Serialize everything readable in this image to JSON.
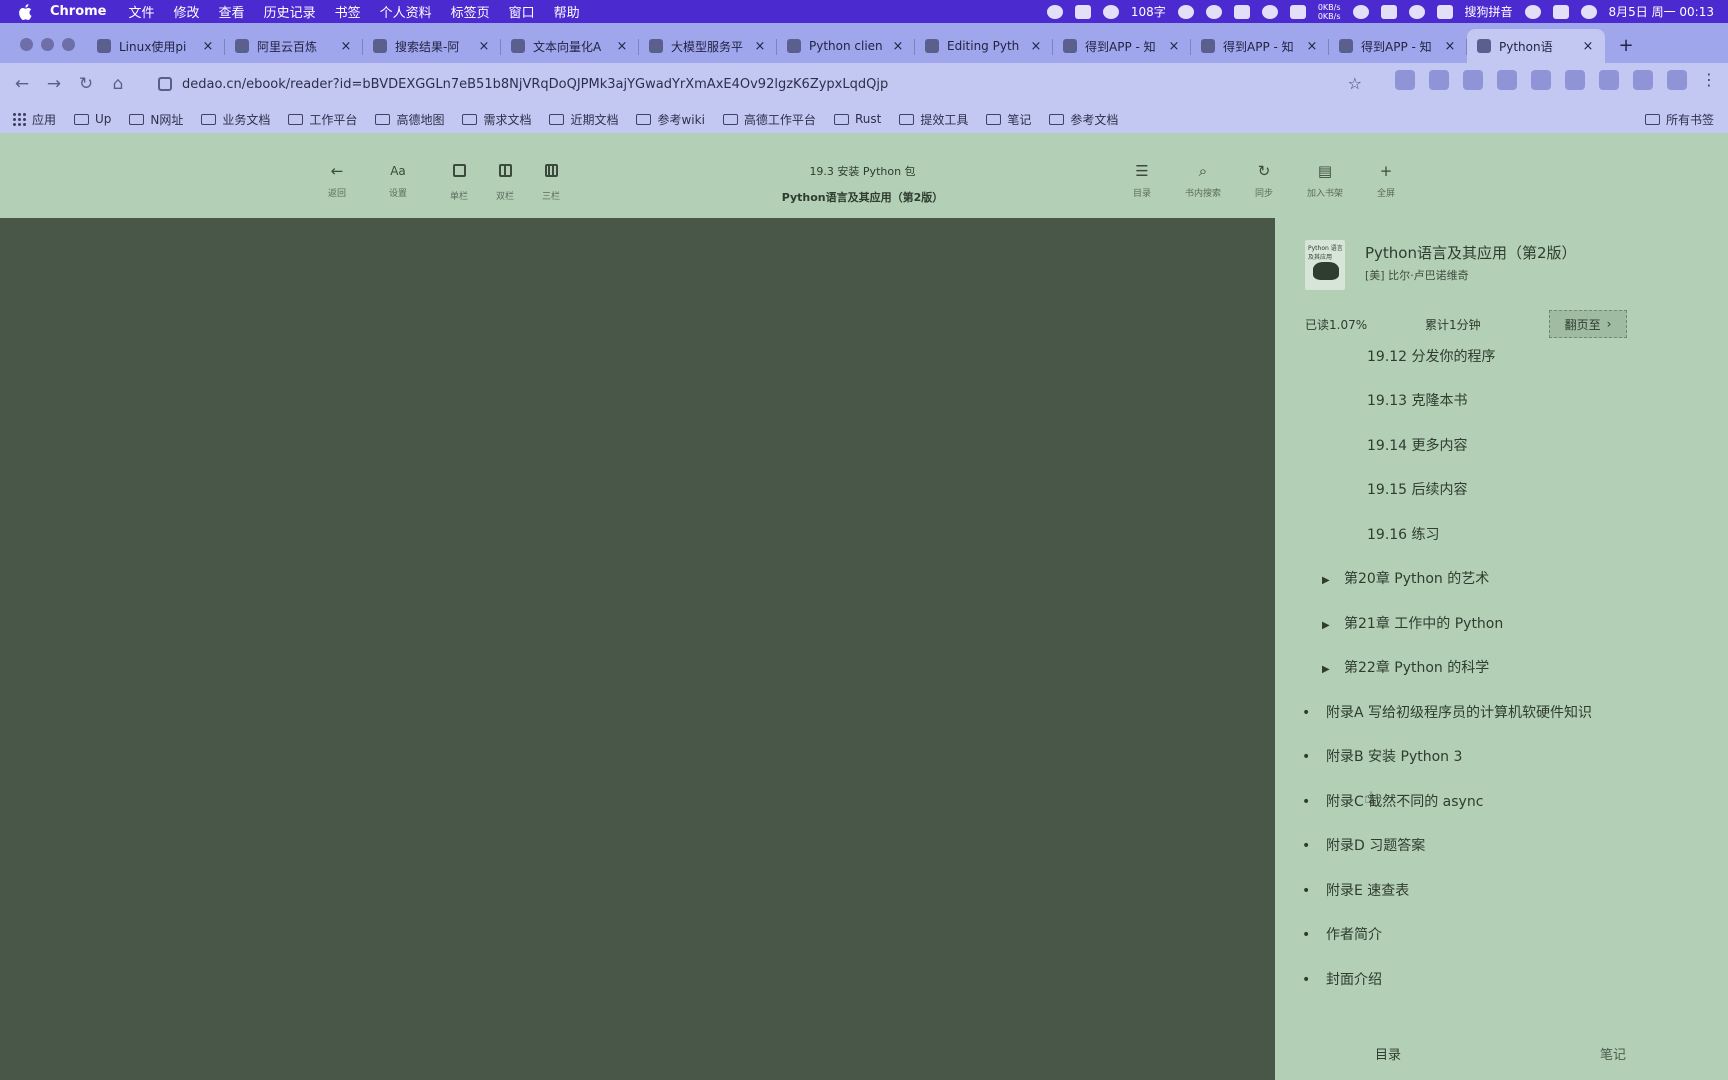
{
  "menubar": {
    "app": "Chrome",
    "items": [
      "文件",
      "修改",
      "查看",
      "历史记录",
      "书签",
      "个人资料",
      "标签页",
      "窗口",
      "帮助"
    ],
    "word_count": "108字",
    "net_up": "0KB/s",
    "net_down": "0KB/s",
    "input_method": "搜狗拼音",
    "datetime": "8月5日 周一 00:13"
  },
  "tabs": [
    {
      "title": "Linux使用pi",
      "active": false
    },
    {
      "title": "阿里云百炼",
      "active": false
    },
    {
      "title": "搜索结果-阿",
      "active": false
    },
    {
      "title": "文本向量化A",
      "active": false
    },
    {
      "title": "大模型服务平",
      "active": false
    },
    {
      "title": "Python clien",
      "active": false
    },
    {
      "title": "Editing Pyth",
      "active": false
    },
    {
      "title": "得到APP - 知",
      "active": false
    },
    {
      "title": "得到APP - 知",
      "active": false
    },
    {
      "title": "得到APP - 知",
      "active": false
    },
    {
      "title": "Python语",
      "active": true
    }
  ],
  "address": {
    "url": "dedao.cn/ebook/reader?id=bBVDEXGGLn7eB51b8NjVRqDoQJPMk3ajYGwadYrXmAxE4Ov92lgzK6ZypxLqdQjp"
  },
  "bookmarks": {
    "apps": "应用",
    "folders": [
      "Up",
      "N网址",
      "业务文档",
      "工作平台",
      "高德地图",
      "需求文档",
      "近期文档",
      "参考wiki",
      "高德工作平台",
      "Rust",
      "提效工具",
      "笔记",
      "参考文档"
    ],
    "all": "所有书签"
  },
  "reader": {
    "chapter": "19.3 安装 Python 包",
    "book": "Python语言及其应用（第2版）",
    "left_buttons": [
      {
        "glyph": "←",
        "label": "返回"
      },
      {
        "glyph": "Aa",
        "label": "设置"
      },
      {
        "glyph": "single-column-icon",
        "label": "单栏"
      },
      {
        "glyph": "two-column-icon",
        "label": "双栏"
      },
      {
        "glyph": "three-column-icon",
        "label": "三栏"
      }
    ],
    "right_buttons": [
      {
        "glyph": "☰",
        "label": "目录"
      },
      {
        "glyph": "⌕",
        "label": "书内搜索"
      },
      {
        "glyph": "↻",
        "label": "同步"
      },
      {
        "glyph": "▤",
        "label": "加入书架"
      },
      {
        "glyph": "+",
        "label": "全屏"
      }
    ]
  },
  "side": {
    "cover_text": "Python\n语言及其应用",
    "book_name": "Python语言及其应用（第2版）",
    "author": "[美] 比尔·卢巴诺维奇",
    "read_pct": "已读1.07%",
    "total_time": "累计1分钟",
    "goto": "翻页至",
    "toc": [
      {
        "text": "19.12 分发你的程序",
        "level": 2
      },
      {
        "text": "19.13 克隆本书",
        "level": 2
      },
      {
        "text": "19.14 更多内容",
        "level": 2
      },
      {
        "text": "19.15 后续内容",
        "level": 2
      },
      {
        "text": "19.16 练习",
        "level": 2
      },
      {
        "text": "第20章 Python 的艺术",
        "level": 1
      },
      {
        "text": "第21章 工作中的 Python",
        "level": 1
      },
      {
        "text": "第22章 Python 的科学",
        "level": 1
      },
      {
        "text": "附录A 写给初级程序员的计算机软硬件知识",
        "level": 0
      },
      {
        "text": "附录B 安装 Python 3",
        "level": 0
      },
      {
        "text": "附录C 截然不同的 async",
        "level": 0
      },
      {
        "text": "附录D 习题答案",
        "level": 0
      },
      {
        "text": "附录E 速查表",
        "level": 0
      },
      {
        "text": "作者简介",
        "level": 0
      },
      {
        "text": "封面介绍",
        "level": 0
      }
    ],
    "footer_toc": "目录",
    "footer_notes": "笔记"
  }
}
